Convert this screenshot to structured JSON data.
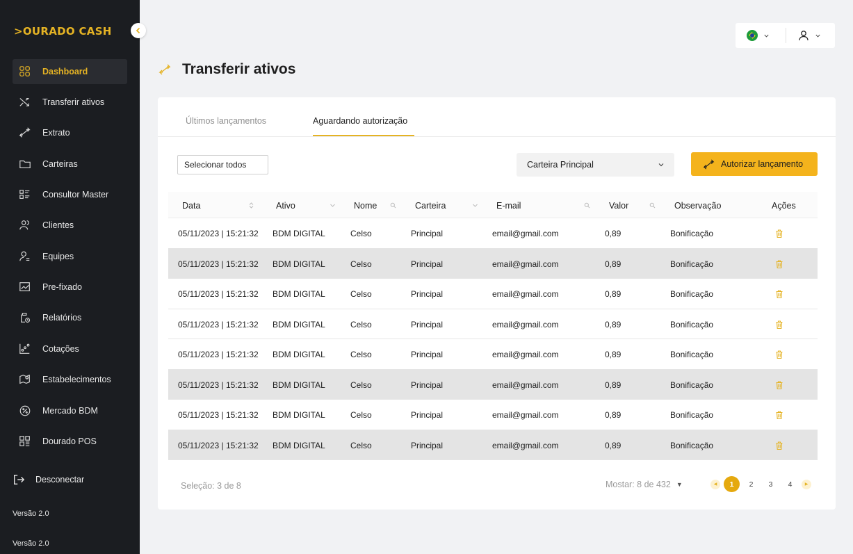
{
  "brand": {
    "logo": ">OURADO CASH"
  },
  "sidebar": {
    "items": [
      {
        "label": "Dashboard",
        "icon": "dashboard-grid-icon",
        "active": true
      },
      {
        "label": "Transferir ativos",
        "icon": "shuffle-icon",
        "active": false
      },
      {
        "label": "Extrato",
        "icon": "transfer-arrows-icon",
        "active": false
      },
      {
        "label": "Carteiras",
        "icon": "folder-icon",
        "active": false
      },
      {
        "label": "Consultor Master",
        "icon": "list-layout-icon",
        "active": false
      },
      {
        "label": "Clientes",
        "icon": "users-icon",
        "active": false
      },
      {
        "label": "Equipes",
        "icon": "user-team-icon",
        "active": false
      },
      {
        "label": "Pre-fixado",
        "icon": "chart-line-icon",
        "active": false
      },
      {
        "label": "Relatórios",
        "icon": "clipboard-icon",
        "active": false
      },
      {
        "label": "Cotações",
        "icon": "chart-points-icon",
        "active": false
      },
      {
        "label": "Estabelecimentos",
        "icon": "map-pin-icon",
        "active": false
      },
      {
        "label": "Mercado BDM",
        "icon": "percent-badge-icon",
        "active": false
      },
      {
        "label": "Dourado POS",
        "icon": "pos-grid-icon",
        "active": false
      }
    ],
    "logout": "Desconectar",
    "versions": [
      "Versão 2.0",
      "Versão 2.0"
    ]
  },
  "header": {
    "language_flag": "brazil-flag-icon"
  },
  "page": {
    "title": "Transferir ativos"
  },
  "tabs": [
    {
      "label": "Últimos lançamentos",
      "active": false
    },
    {
      "label": "Aguardando autorização",
      "active": true
    }
  ],
  "toolbar": {
    "select_all": "Selecionar todos",
    "wallet_select": "Carteira Principal",
    "authorize_button": "Autorizar lançamento"
  },
  "table": {
    "columns": [
      "Data",
      "Ativo",
      "Nome",
      "Carteira",
      "E-mail",
      "Valor",
      "Observação",
      "Ações"
    ],
    "rows": [
      {
        "data": "05/11/2023 | 15:21:32",
        "ativo": "BDM DIGITAL",
        "nome": "Celso",
        "carteira": "Principal",
        "email": "email@gmail.com",
        "valor": "0,89",
        "obs": "Bonificação",
        "selected": false
      },
      {
        "data": "05/11/2023 | 15:21:32",
        "ativo": "BDM DIGITAL",
        "nome": "Celso",
        "carteira": "Principal",
        "email": "email@gmail.com",
        "valor": "0,89",
        "obs": "Bonificação",
        "selected": true
      },
      {
        "data": "05/11/2023 | 15:21:32",
        "ativo": "BDM DIGITAL",
        "nome": "Celso",
        "carteira": "Principal",
        "email": "email@gmail.com",
        "valor": "0,89",
        "obs": "Bonificação",
        "selected": false
      },
      {
        "data": "05/11/2023 | 15:21:32",
        "ativo": "BDM DIGITAL",
        "nome": "Celso",
        "carteira": "Principal",
        "email": "email@gmail.com",
        "valor": "0,89",
        "obs": "Bonificação",
        "selected": false
      },
      {
        "data": "05/11/2023 | 15:21:32",
        "ativo": "BDM DIGITAL",
        "nome": "Celso",
        "carteira": "Principal",
        "email": "email@gmail.com",
        "valor": "0,89",
        "obs": "Bonificação",
        "selected": false
      },
      {
        "data": "05/11/2023 | 15:21:32",
        "ativo": "BDM DIGITAL",
        "nome": "Celso",
        "carteira": "Principal",
        "email": "email@gmail.com",
        "valor": "0,89",
        "obs": "Bonificação",
        "selected": true
      },
      {
        "data": "05/11/2023 | 15:21:32",
        "ativo": "BDM DIGITAL",
        "nome": "Celso",
        "carteira": "Principal",
        "email": "email@gmail.com",
        "valor": "0,89",
        "obs": "Bonificação",
        "selected": false
      },
      {
        "data": "05/11/2023 | 15:21:32",
        "ativo": "BDM DIGITAL",
        "nome": "Celso",
        "carteira": "Principal",
        "email": "email@gmail.com",
        "valor": "0,89",
        "obs": "Bonificação",
        "selected": true
      }
    ]
  },
  "footer": {
    "selection": "Seleção: 3 de 8",
    "show_count": "Mostar: 8 de 432",
    "pages": [
      "1",
      "2",
      "3",
      "4"
    ],
    "current_page": "1"
  },
  "colors": {
    "accent": "#e5b324",
    "sidebar_bg": "#1b1d21",
    "button_bg": "#f4b31c",
    "selected_row": "#e4e4e4"
  }
}
